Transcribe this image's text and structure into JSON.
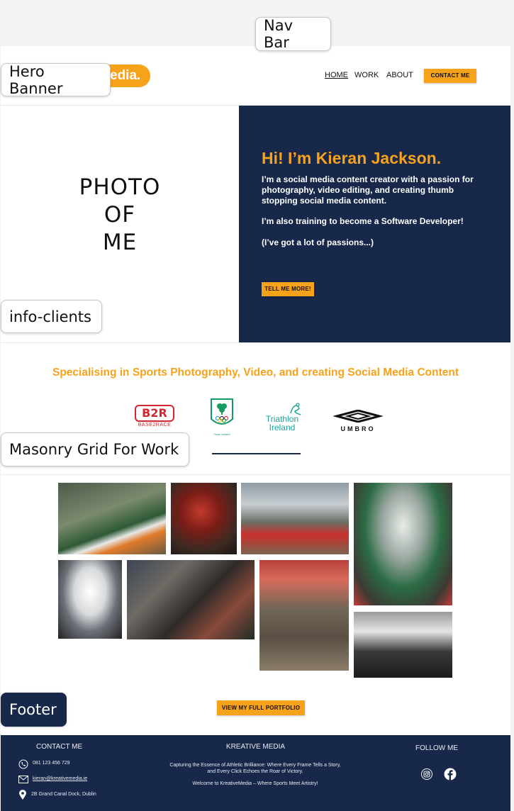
{
  "annotations": {
    "nav_bar": "Nav Bar",
    "hero_banner": "Hero Banner",
    "info_clients": "info-clients",
    "masonry": "Masonry Grid For Work",
    "footer": "Footer"
  },
  "header": {
    "logo_text": "edia.",
    "nav": {
      "home": "HOME",
      "work": "WORK",
      "about": "ABOUT"
    },
    "contact_button": "CONTACT ME"
  },
  "hero": {
    "photo_placeholder": [
      "PHOTO",
      "OF",
      "ME"
    ],
    "title": "Hi! I’m Kieran Jackson.",
    "para1": "I’m a social media content creator with a passion for photography, video editing, and creating thumb stopping social media content.",
    "para2": "I’m also training to become a Software Developer!",
    "para3": "(I’ve got a lot of passions...)",
    "cta": "TELL ME MORE!"
  },
  "clients": {
    "heading": "Specialising in Sports Photography, Video, and creating Social Media Content",
    "b2r": {
      "mark": "B2R",
      "sub": "BASE2RACE"
    },
    "team_ireland": "Team Ireland",
    "triathlon": [
      "Triathlon",
      "Ireland"
    ],
    "umbro": "UMBRO"
  },
  "gallery": {
    "button": "VIEW MY FULL PORTFOLIO"
  },
  "footer": {
    "contact_heading": "CONTACT ME",
    "phone": "081 123 456 729",
    "email": "kieran@kreativemedia.ie",
    "address": "2B Grand Canal Dock, Dublin",
    "brand_heading": "KREATIVE MEDIA",
    "tagline": "Capturing the Essence of Athletic Brilliance: Where Every Frame Tells a Story, and Every Click Echoes the Roar of Victory.",
    "welcome": "Welcome to KreativeMedia – Where Sports Meet Artistry!",
    "follow_heading": "FOLLOW ME"
  },
  "colors": {
    "accent": "#f7a21b",
    "navy": "#17284a"
  }
}
